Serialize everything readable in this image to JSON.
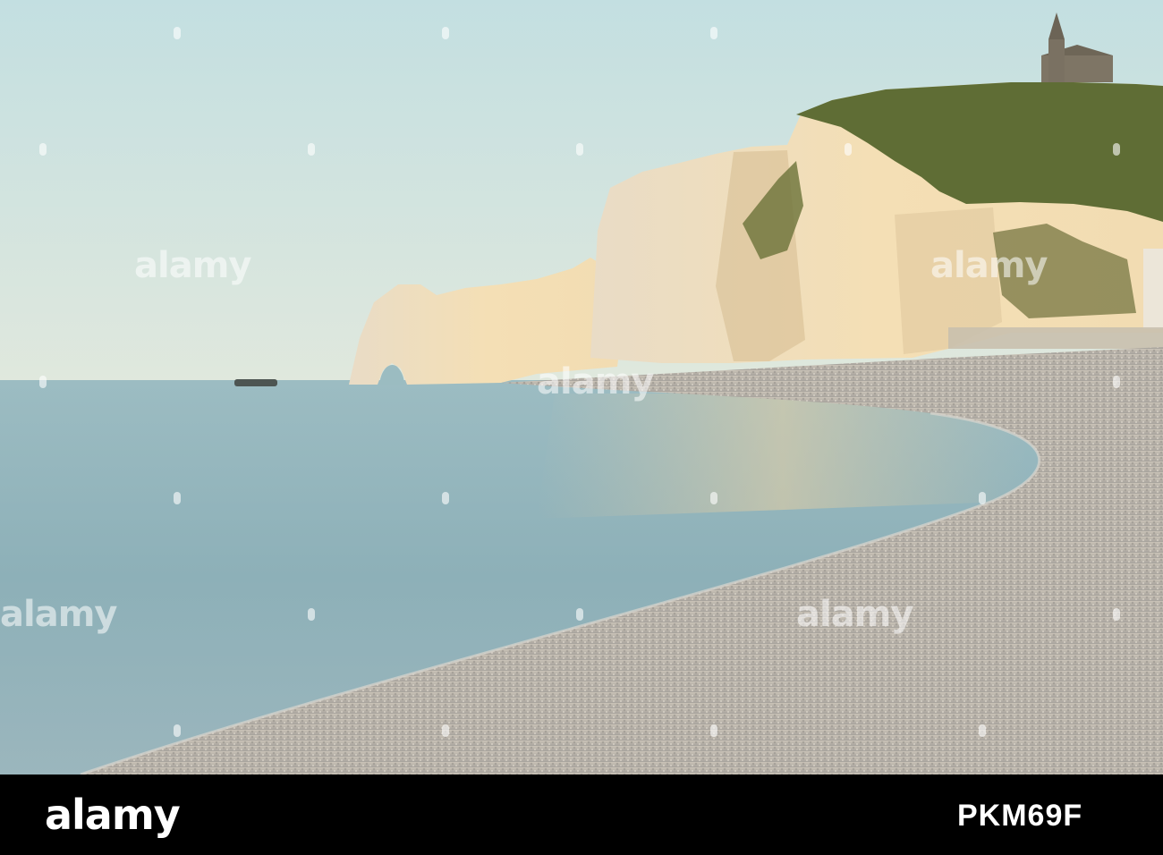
{
  "photo": {
    "scene": "chalk-cliffs-beach",
    "colors": {
      "sky_top": "#c5dfe0",
      "sky_bottom": "#dde6dc",
      "sea": "#8fb3ba",
      "cliff_light": "#f6e3c0",
      "cliff_shadow": "#d8bf95",
      "grass": "#5e6b33",
      "pebbles": "#b7b2aa"
    }
  },
  "watermark": {
    "text": "alamy",
    "marks": [
      "a",
      "a",
      "a",
      "a"
    ]
  },
  "footer": {
    "logo": "alamy",
    "image_id": "PKM69F"
  }
}
